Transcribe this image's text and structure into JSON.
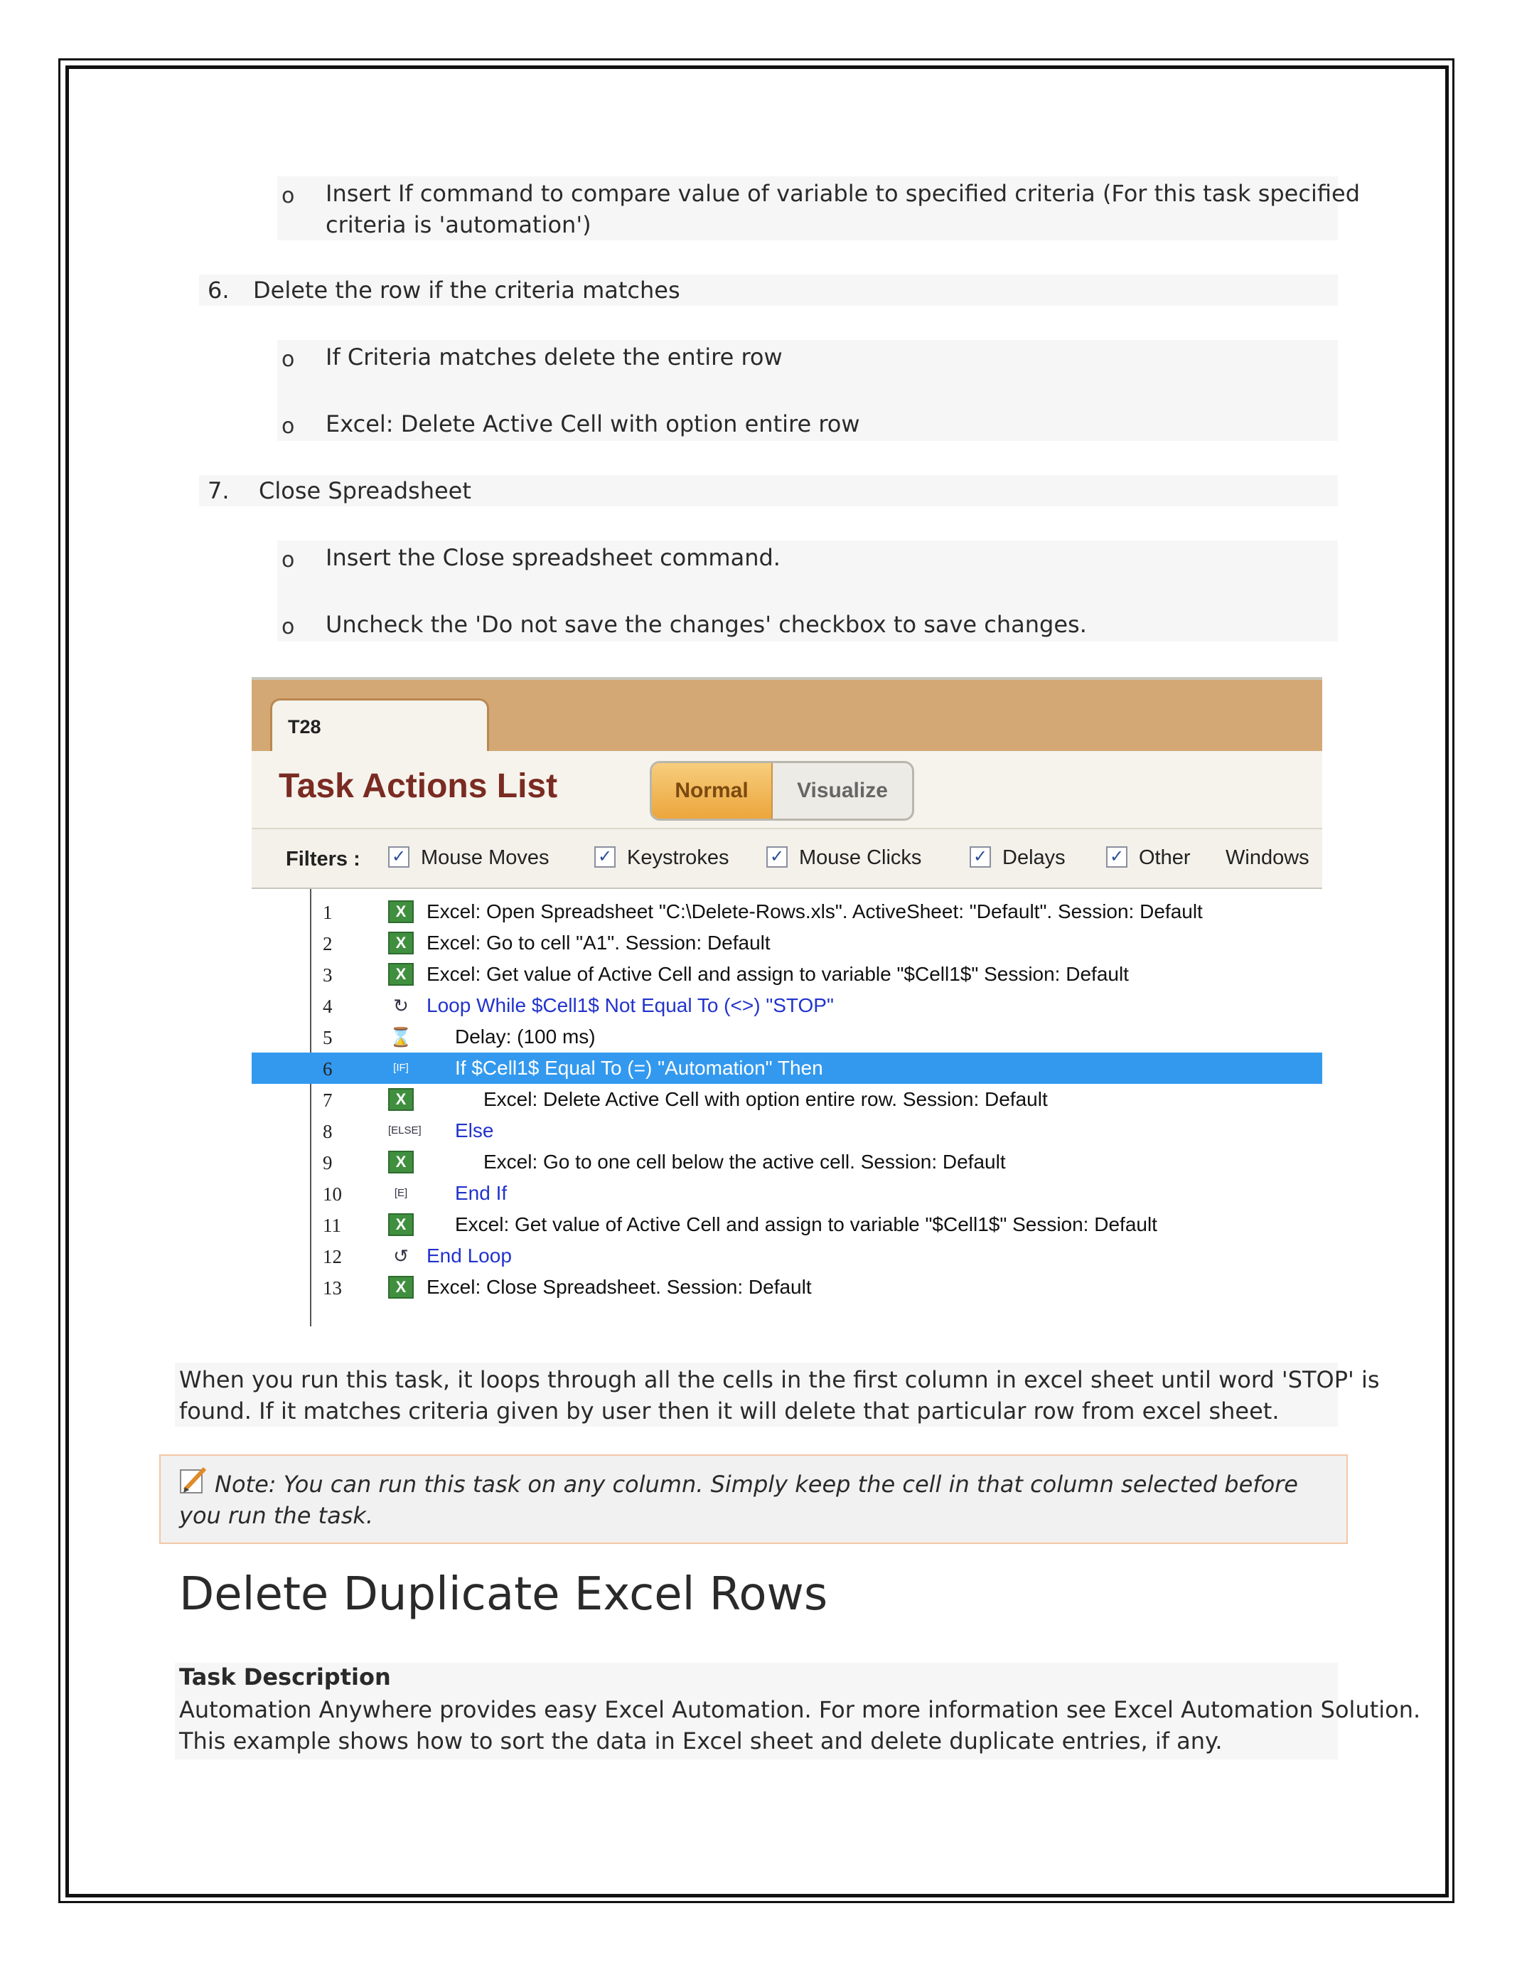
{
  "list_items": {
    "if_compare": [
      "Insert If command to compare value of variable to specified criteria (For this task specified",
      "criteria is 'automation')"
    ],
    "step6_num": "6.",
    "step6": "Delete the row if the criteria matches",
    "if_criteria": "If Criteria matches delete the entire row",
    "excel_delete": "Excel: Delete Active Cell with option entire row",
    "step7_num": "7.",
    "step7": "Close Spreadsheet",
    "insert_close": "Insert the Close spreadsheet command.",
    "uncheck": "Uncheck the 'Do not save the changes' checkbox to save changes.",
    "bullet": "o"
  },
  "screenshot": {
    "tab": "T28",
    "title": "Task Actions List",
    "toggle_normal": "Normal",
    "toggle_visualize": "Visualize",
    "filters_label": "Filters :",
    "filters": [
      "Mouse Moves",
      "Keystrokes",
      "Mouse Clicks",
      "Delays",
      "Other",
      "Windows"
    ],
    "check_mark": "✓",
    "rows": [
      {
        "n": "1",
        "icon": "excel",
        "text": "Excel: Open Spreadsheet \"C:\\Delete-Rows.xls\". ActiveSheet: \"Default\". Session: Default"
      },
      {
        "n": "2",
        "icon": "excel",
        "text": "Excel: Go to cell \"A1\". Session: Default"
      },
      {
        "n": "3",
        "icon": "excel",
        "text": "Excel: Get value of Active Cell and assign to variable \"$Cell1$\" Session: Default"
      },
      {
        "n": "4",
        "icon": "loop",
        "text": "Loop While $Cell1$ Not Equal To (<>) \"STOP\""
      },
      {
        "n": "5",
        "icon": "delay",
        "text": "Delay: (100 ms)"
      },
      {
        "n": "6",
        "icon": "if",
        "text": "If $Cell1$ Equal To (=) \"Automation\" Then"
      },
      {
        "n": "7",
        "icon": "excel",
        "text": "Excel: Delete Active Cell with option entire row. Session: Default"
      },
      {
        "n": "8",
        "icon": "else",
        "text": "Else"
      },
      {
        "n": "9",
        "icon": "excel",
        "text": "Excel: Go to one cell below the active cell. Session: Default"
      },
      {
        "n": "10",
        "icon": "endif",
        "text": "End If"
      },
      {
        "n": "11",
        "icon": "excel",
        "text": "Excel: Get value of Active Cell and assign to variable \"$Cell1$\" Session: Default"
      },
      {
        "n": "12",
        "icon": "endloop",
        "text": "End Loop"
      },
      {
        "n": "13",
        "icon": "excel",
        "text": "Excel: Close Spreadsheet. Session: Default"
      }
    ],
    "selected_row": 6,
    "icon_glyphs": {
      "excel": "X",
      "loop": "↻",
      "delay": "⌛",
      "if": "[IF]",
      "else": "[ELSE]",
      "endif": "[E]",
      "endloop": "↺"
    }
  },
  "paragraph": [
    "When you run this task, it loops through all the cells in the first column in excel sheet until word 'STOP' is",
    "found. If it matches criteria given by user then it will delete that particular row from excel sheet."
  ],
  "note": "Note: You can run this task on any column. Simply keep the cell in that column selected before you run the task.",
  "heading": "Delete Duplicate Excel Rows",
  "task_description": {
    "label": "Task Description",
    "lines": [
      "Automation Anywhere provides easy Excel Automation. For more information see Excel Automation Solution.",
      "This example shows how to sort the data in Excel sheet and delete duplicate entries, if any."
    ]
  },
  "colors": {
    "accent_tab": "#d4a875",
    "title": "#7a2b22",
    "selected_row": "#3399ee",
    "blue_text": "#2233cc",
    "excel_icon": "#3f8f3f"
  }
}
